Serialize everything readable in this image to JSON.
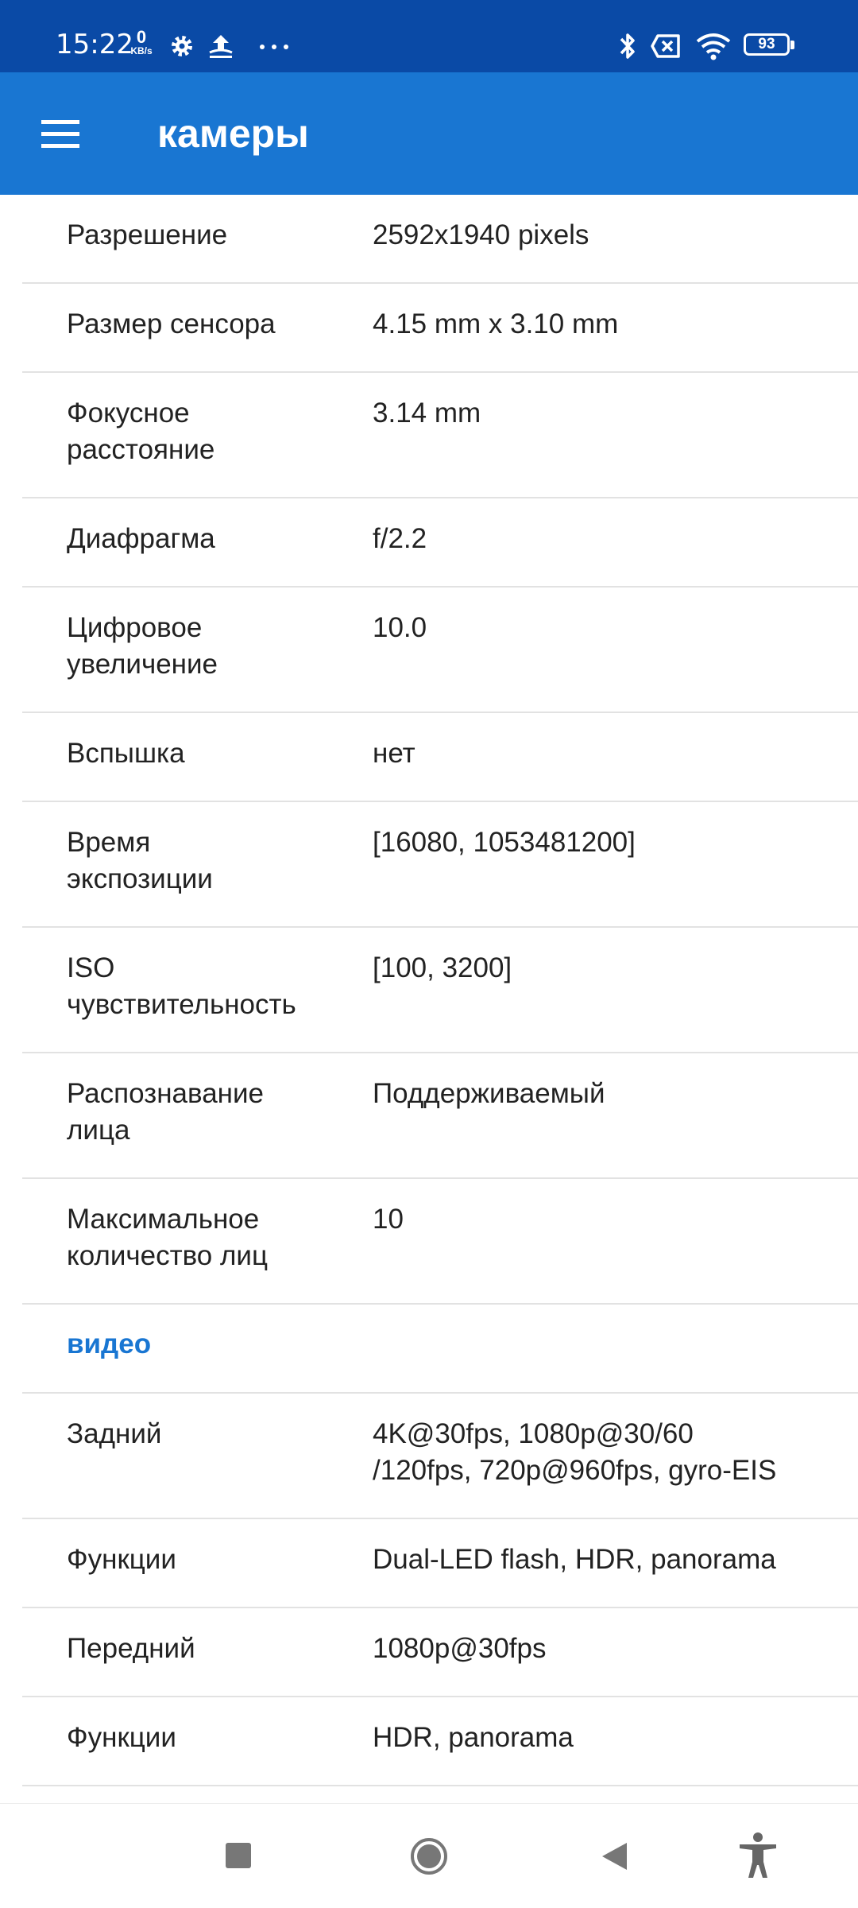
{
  "status_bar": {
    "time": "15:22",
    "net_speed_value": "0",
    "net_speed_unit": "KB/s",
    "battery_level": "93",
    "icons": [
      "gear-icon",
      "upload-icon",
      "more-icon",
      "bluetooth-icon",
      "sim-off-icon",
      "wifi-icon",
      "battery-icon"
    ]
  },
  "app_bar": {
    "title": "камеры",
    "menu_icon": "hamburger-menu-icon"
  },
  "rows": [
    {
      "label": "Разрешение",
      "value": "2592x1940 pixels"
    },
    {
      "label": "Размер сенсора",
      "value": "4.15 mm x 3.10 mm"
    },
    {
      "label": "Фокусное\nрасстояние",
      "value": "3.14 mm"
    },
    {
      "label": "Диафрагма",
      "value": "f/2.2"
    },
    {
      "label": "Цифровое\nувеличение",
      "value": "10.0"
    },
    {
      "label": "Вспышка",
      "value": "нет"
    },
    {
      "label": "Время\nэкспозиции",
      "value": "[16080, 1053481200]"
    },
    {
      "label": "ISO\nчувствительность",
      "value": "[100, 3200]"
    },
    {
      "label": "Распознавание\nлица",
      "value": "Поддерживаемый"
    },
    {
      "label": "Максимальное\nколичество лиц",
      "value": "10"
    }
  ],
  "video_section": {
    "title": "видео",
    "rows": [
      {
        "label": "Задний",
        "value": "4K@30fps, 1080p@30/60\n/120fps, 720p@960fps, gyro-EIS"
      },
      {
        "label": "Функции",
        "value": "Dual-LED flash, HDR, panorama"
      },
      {
        "label": "Передний",
        "value": "1080p@30fps"
      },
      {
        "label": "Функции",
        "value": "HDR, panorama"
      }
    ]
  },
  "nav_bar": {
    "icons": [
      "recent-apps-icon",
      "home-icon",
      "back-icon",
      "accessibility-icon"
    ]
  },
  "colors": {
    "status_bar": "#0a4aa6",
    "app_bar": "#1976d2",
    "accent": "#1976d2",
    "text": "#222222",
    "divider": "#e2e2e2"
  }
}
